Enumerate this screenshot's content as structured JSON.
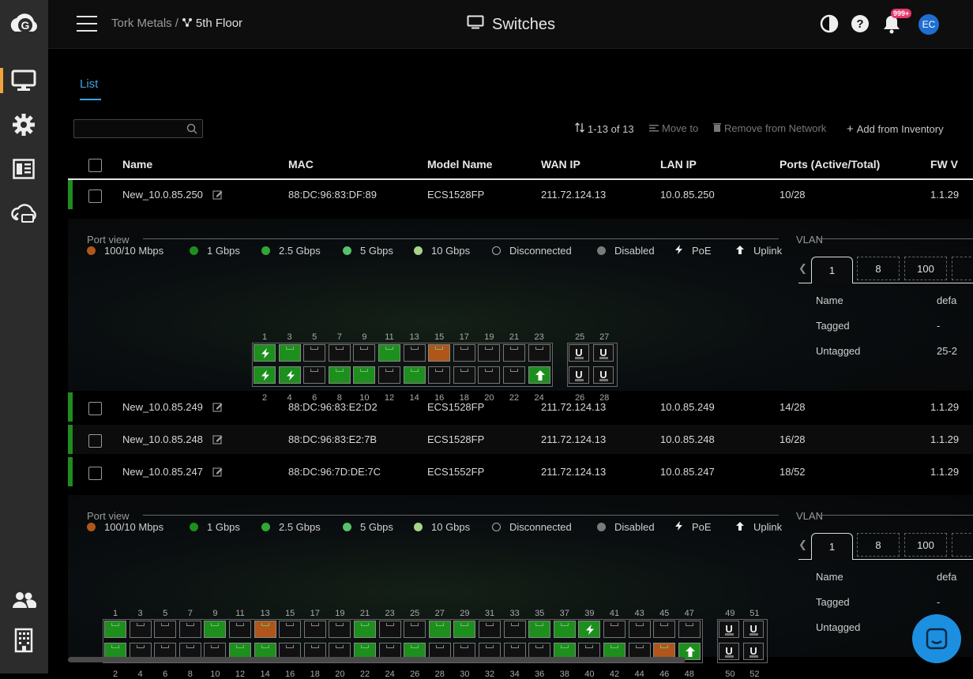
{
  "app": {
    "brand_letter": "G"
  },
  "breadcrumb": {
    "org": "Tork Metals",
    "separator": "/",
    "site": "5th Floor"
  },
  "header": {
    "title": "Switches",
    "notification_badge": "999+",
    "avatar_initials": "EC"
  },
  "tabs": [
    {
      "label": "List"
    }
  ],
  "toolbar": {
    "pagination": "1-13 of 13",
    "move_to": "Move to",
    "remove": "Remove from Network",
    "add": "Add from Inventory"
  },
  "table": {
    "columns": [
      "Name",
      "MAC",
      "Model Name",
      "WAN IP",
      "LAN IP",
      "Ports (Active/Total)",
      "FW V"
    ],
    "rows": [
      {
        "name": "New_10.0.85.250",
        "mac": "88:DC:96:83:DF:89",
        "model": "ECS1528FP",
        "wan": "211.72.124.13",
        "lan": "10.0.85.250",
        "ports": "10/28",
        "fw": "1.1.29"
      },
      {
        "name": "New_10.0.85.249",
        "mac": "88:DC:96:83:E2:D2",
        "model": "ECS1528FP",
        "wan": "211.72.124.13",
        "lan": "10.0.85.249",
        "ports": "14/28",
        "fw": "1.1.29"
      },
      {
        "name": "New_10.0.85.248",
        "mac": "88:DC:96:83:E2:7B",
        "model": "ECS1528FP",
        "wan": "211.72.124.13",
        "lan": "10.0.85.248",
        "ports": "16/28",
        "fw": "1.1.29"
      },
      {
        "name": "New_10.0.85.247",
        "mac": "88:DC:96:7D:DE:7C",
        "model": "ECS1552FP",
        "wan": "211.72.124.13",
        "lan": "10.0.85.247",
        "ports": "18/52",
        "fw": "1.1.29"
      }
    ]
  },
  "port_view": {
    "title": "Port view",
    "legend": [
      {
        "label": "100/10 Mbps",
        "color": "#b0561a"
      },
      {
        "label": "1 Gbps",
        "color": "#1d8f1d"
      },
      {
        "label": "2.5 Gbps",
        "color": "#2fa834"
      },
      {
        "label": "5 Gbps",
        "color": "#56c06a"
      },
      {
        "label": "10 Gbps",
        "color": "#a8d38a"
      },
      {
        "label": "Disconnected",
        "color": "hollow"
      },
      {
        "label": "Disabled",
        "color": "#7a7a7a"
      },
      {
        "label": "PoE",
        "icon": "bolt-icon"
      },
      {
        "label": "Uplink",
        "icon": "arrow-up-icon"
      }
    ],
    "uplink_port_label": "U"
  },
  "panel1": {
    "top_ports": [
      "1",
      "3",
      "5",
      "7",
      "9",
      "11",
      "13",
      "15",
      "17",
      "19",
      "21",
      "23"
    ],
    "bottom_ports": [
      "2",
      "4",
      "6",
      "8",
      "10",
      "12",
      "14",
      "16",
      "18",
      "20",
      "22",
      "24"
    ],
    "sfp_top": [
      "25",
      "27"
    ],
    "sfp_bottom": [
      "26",
      "28"
    ],
    "top_state": [
      "gp",
      "g",
      "",
      "",
      "",
      "g",
      "",
      "o",
      "",
      "",
      "",
      ""
    ],
    "bottom_state": [
      "gp",
      "gp",
      "",
      "g",
      "g",
      "",
      "g",
      "",
      "",
      "",
      "",
      "gu"
    ]
  },
  "panel2": {
    "top_ports": [
      "1",
      "3",
      "5",
      "7",
      "9",
      "11",
      "13",
      "15",
      "17",
      "19",
      "21",
      "23",
      "25",
      "27",
      "29",
      "31",
      "33",
      "35",
      "37",
      "39",
      "41",
      "43",
      "45",
      "47"
    ],
    "bottom_ports": [
      "2",
      "4",
      "6",
      "8",
      "10",
      "12",
      "14",
      "16",
      "18",
      "20",
      "22",
      "24",
      "26",
      "28",
      "30",
      "32",
      "34",
      "36",
      "38",
      "40",
      "42",
      "44",
      "46",
      "48"
    ],
    "sfp_top": [
      "49",
      "51"
    ],
    "sfp_bottom": [
      "50",
      "52"
    ],
    "top_state": [
      "g",
      "",
      "",
      "",
      "g",
      "",
      "o",
      "",
      "",
      "",
      "g",
      "",
      "",
      "g",
      "g",
      "",
      "",
      "g",
      "g",
      "gp",
      "",
      "",
      "",
      ""
    ],
    "bottom_state": [
      "g",
      "",
      "",
      "",
      "",
      "g",
      "g",
      "",
      "",
      "",
      "g",
      "",
      "g",
      "",
      "",
      "",
      "",
      "",
      "g",
      "",
      "g",
      "",
      "o",
      "gu"
    ]
  },
  "vlan": {
    "title": "VLAN",
    "tabs": [
      "1",
      "8",
      "100"
    ],
    "fields": [
      {
        "label": "Name",
        "value": "defa"
      },
      {
        "label": "Tagged",
        "value": "-"
      },
      {
        "label": "Untagged",
        "value": "25-2"
      }
    ]
  },
  "vlan2": {
    "fields": [
      {
        "label": "Name",
        "value": "defa"
      },
      {
        "label": "Tagged",
        "value": "-"
      },
      {
        "label": "Untagged",
        "value": ""
      }
    ]
  }
}
